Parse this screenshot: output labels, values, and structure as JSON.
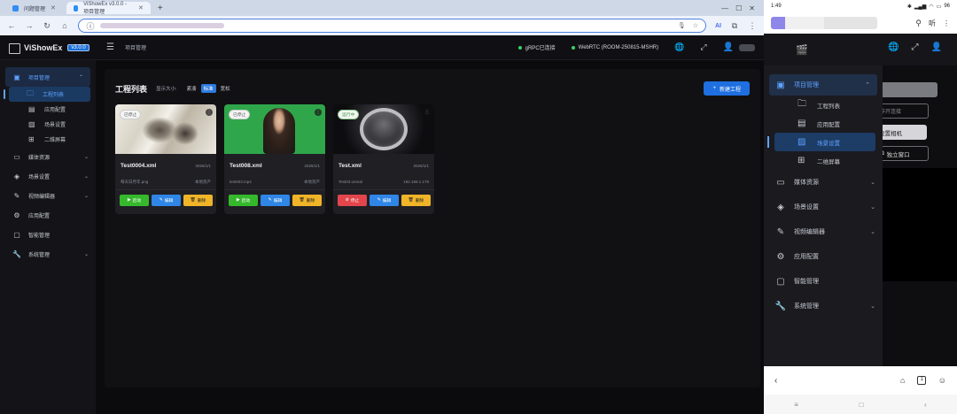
{
  "browser": {
    "tabs": [
      {
        "title": "问题管理"
      },
      {
        "title": "ViShowEx v3.0.0 - 项目管理"
      }
    ],
    "ai_label": "AI"
  },
  "app": {
    "title": "ViShowEx",
    "version": "v3.0.0",
    "breadcrumb": "项目管理",
    "status_grpc": "gRPC已连接",
    "status_webrtc": "WebRTC (ROOM-250815-MSHR)"
  },
  "sidebar": {
    "items": [
      {
        "label": "项目管理",
        "icon": "project-icon",
        "open": true
      },
      {
        "label": "媒体资源",
        "icon": "media-icon"
      },
      {
        "label": "场景设置",
        "icon": "scene-icon"
      },
      {
        "label": "视频编辑器",
        "icon": "edit-icon"
      },
      {
        "label": "应用配置",
        "icon": "gear-icon"
      },
      {
        "label": "智能管理",
        "icon": "smart-icon"
      },
      {
        "label": "系统管理",
        "icon": "wrench-icon"
      }
    ],
    "subitems": [
      {
        "label": "工程列表",
        "icon": "folder-icon",
        "selected": true
      },
      {
        "label": "应用配置",
        "icon": "config-icon"
      },
      {
        "label": "场景设置",
        "icon": "image-icon"
      },
      {
        "label": "二维屏幕",
        "icon": "grid-icon"
      }
    ]
  },
  "main": {
    "title": "工程列表",
    "size_label": "显示大小:",
    "size_options": [
      "紧凑",
      "标准",
      "宽松"
    ],
    "size_selected": "标准",
    "new_button": "新建工程"
  },
  "cards": [
    {
      "name": "Test0004.xml",
      "date": "2026/1/1",
      "file": "每天日月年.png",
      "meta": "本地资产",
      "badge": "已停止",
      "state": "stopped",
      "primary": "启动"
    },
    {
      "name": "Test008.xml",
      "date": "2026/1/1",
      "file": "test003.mp4",
      "meta": "本地资产",
      "badge": "已停止",
      "state": "stopped",
      "primary": "启动"
    },
    {
      "name": "Test.xml",
      "date": "2026/1/1",
      "file": "Test03.unreal",
      "meta": "192.168.1.178",
      "badge": "运行中",
      "state": "running",
      "primary": "停止"
    }
  ],
  "card_actions": {
    "edit": "编辑",
    "delete": "删除"
  },
  "phone": {
    "time": "1:49",
    "battery": "96",
    "listen": "听",
    "drawer_items": [
      {
        "label": "项目管理",
        "open": true
      },
      {
        "label": "媒体资源"
      },
      {
        "label": "场景设置"
      },
      {
        "label": "视频编辑器"
      },
      {
        "label": "应用配置"
      },
      {
        "label": "智能管理"
      },
      {
        "label": "系统管理"
      }
    ],
    "drawer_subitems": [
      {
        "label": "工程列表"
      },
      {
        "label": "应用配置"
      },
      {
        "label": "场景设置",
        "selected": true
      },
      {
        "label": "二维屏幕"
      }
    ],
    "bg_field": "非开连接",
    "bg_button": "设置相机",
    "bg_window": "独立窗口",
    "tab_count": "1"
  },
  "colors": {
    "accent": "#2f86e6",
    "start": "#35b82c",
    "stop": "#e2454b",
    "delete": "#f0b429"
  }
}
